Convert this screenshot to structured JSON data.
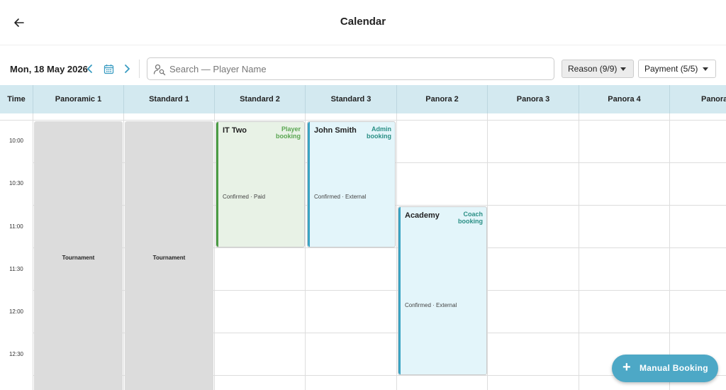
{
  "header": {
    "title": "Calendar"
  },
  "toolbar": {
    "date": "Mon, 18 May 2026",
    "search_placeholder": "Search — Player Name",
    "search_value": "",
    "reason_filter": "Reason (9/9)",
    "payment_filter": "Payment (5/5)"
  },
  "grid": {
    "time_header": "Time",
    "columns": [
      "Panoramic 1",
      "Standard 1",
      "Standard 2",
      "Standard 3",
      "Panora 2",
      "Panora 3",
      "Panora 4",
      "Panora"
    ],
    "times": [
      "10:00",
      "10:30",
      "11:00",
      "11:30",
      "12:00",
      "12:30"
    ]
  },
  "blocks": [
    {
      "label": "Tournament"
    },
    {
      "label": "Tournament"
    }
  ],
  "bookings": [
    {
      "name": "IT Two",
      "type_line1": "Player",
      "type_line2": "booking",
      "status": "Confirmed · Paid"
    },
    {
      "name": "John Smith",
      "type_line1": "Admin",
      "type_line2": "booking",
      "status": "Confirmed · External"
    },
    {
      "name": "Academy",
      "type_line1": "Coach",
      "type_line2": "booking",
      "status": "Confirmed · External"
    }
  ],
  "fab": {
    "label": "Manual Booking"
  },
  "colors": {
    "accent": "#4da8c6",
    "header_bg": "#d3e9f0",
    "player_bar": "#4b9c44",
    "cyan_bar": "#3aa3c3",
    "blocked": "#dcdcdc"
  }
}
